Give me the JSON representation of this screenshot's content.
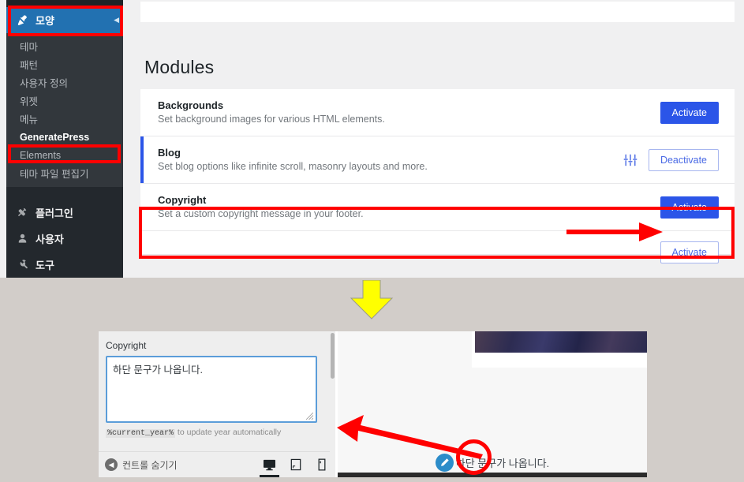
{
  "admin": {
    "sidebar": {
      "active_menu": {
        "label": "모양",
        "icon": "appearance-brush-icon"
      },
      "submenu": [
        {
          "label": "테마",
          "current": false
        },
        {
          "label": "패턴",
          "current": false
        },
        {
          "label": "사용자 정의",
          "current": false
        },
        {
          "label": "위젯",
          "current": false
        },
        {
          "label": "메뉴",
          "current": false
        },
        {
          "label": "GeneratePress",
          "current": true
        },
        {
          "label": "Elements",
          "current": false
        },
        {
          "label": "테마 파일 편집기",
          "current": false
        }
      ],
      "lower_menu": [
        {
          "label": "플러그인",
          "icon": "plug-icon"
        },
        {
          "label": "사용자",
          "icon": "user-icon"
        },
        {
          "label": "도구",
          "icon": "wrench-icon"
        }
      ]
    },
    "page_title": "Modules",
    "modules": [
      {
        "name": "Backgrounds",
        "description": "Set background images for various HTML elements.",
        "active": false,
        "has_settings": false,
        "button": "Activate",
        "button_style": "primary"
      },
      {
        "name": "Blog",
        "description": "Set blog options like infinite scroll, masonry layouts and more.",
        "active": true,
        "has_settings": true,
        "settings_icon": "sliders-icon",
        "button": "Deactivate",
        "button_style": "secondary"
      },
      {
        "name": "Copyright",
        "description": "Set a custom copyright message in your footer.",
        "active": false,
        "has_settings": false,
        "button": "Activate",
        "button_style": "primary"
      }
    ],
    "partial_module": {
      "button": "Activate"
    }
  },
  "customizer": {
    "section_label": "Copyright",
    "textarea_value": "하단 문구가 나옵니다.",
    "hint_code": "%current_year%",
    "hint_text": " to update year automatically",
    "hide_controls_label": "컨트롤 숨기기",
    "device_buttons": [
      {
        "name": "desktop",
        "selected": true
      },
      {
        "name": "tablet",
        "selected": false
      },
      {
        "name": "mobile",
        "selected": false
      }
    ]
  },
  "preview": {
    "footer_text": "하단 문구가 나옵니다.",
    "edit_badge_icon": "pencil-icon"
  },
  "annotations": {
    "highlight_color": "#ff0000",
    "arrow_color": "#ff0000",
    "down_arrow_color": "#ffff00",
    "boxes": [
      "모양",
      "GeneratePress",
      "Copyright module row"
    ],
    "arrows": [
      "points to Copyright Activate button",
      "points from preview footer to customizer textarea"
    ],
    "circles": [
      "edit pencil badge in preview"
    ]
  },
  "colors": {
    "wp_blue": "#2271b1",
    "gp_blue": "#2b55e8",
    "sidebar_dark": "#23282d",
    "submenu_dark": "#32373c",
    "red": "#ff0000",
    "yellow": "#ffff00"
  }
}
